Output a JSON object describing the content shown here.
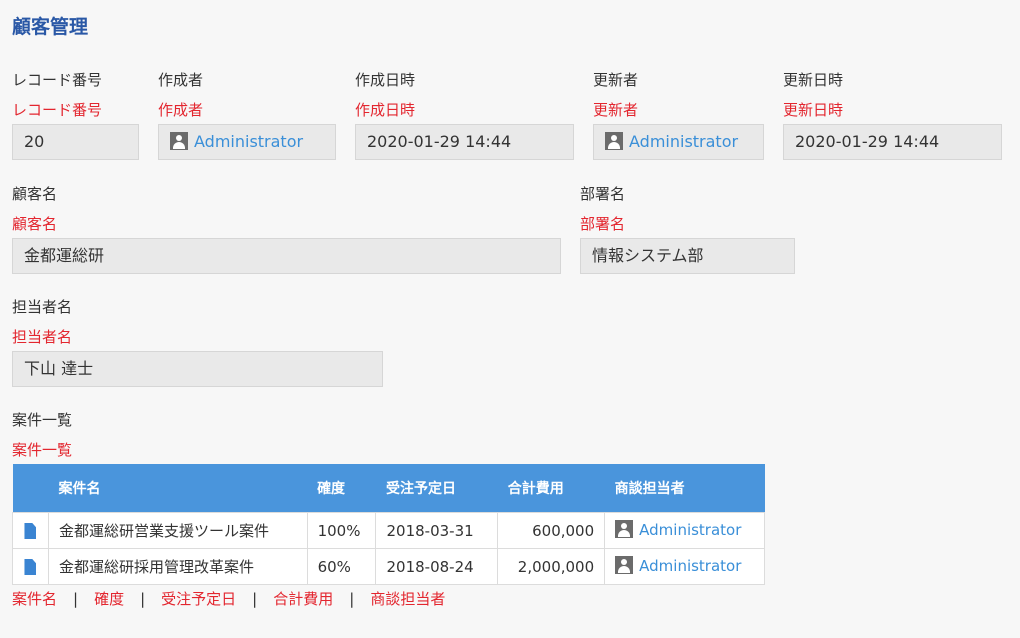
{
  "app": {
    "title": "顧客管理"
  },
  "fields": {
    "record_no": {
      "label": "レコード番号",
      "code": "レコード番号",
      "value": "20"
    },
    "created_by": {
      "label": "作成者",
      "code": "作成者",
      "value": "Administrator"
    },
    "created_at": {
      "label": "作成日時",
      "code": "作成日時",
      "value": "2020-01-29 14:44"
    },
    "updated_by": {
      "label": "更新者",
      "code": "更新者",
      "value": "Administrator"
    },
    "updated_at": {
      "label": "更新日時",
      "code": "更新日時",
      "value": "2020-01-29 14:44"
    },
    "customer_name": {
      "label": "顧客名",
      "code": "顧客名",
      "value": "金都運総研"
    },
    "department": {
      "label": "部署名",
      "code": "部署名",
      "value": "情報システム部"
    },
    "contact_person": {
      "label": "担当者名",
      "code": "担当者名",
      "value": "下山 達士"
    },
    "case_list": {
      "label": "案件一覧",
      "code": "案件一覧"
    }
  },
  "case_table": {
    "headers": [
      "案件名",
      "確度",
      "受注予定日",
      "合計費用",
      "商談担当者"
    ],
    "rows": [
      {
        "name": "金都運総研営業支援ツール案件",
        "probability": "100%",
        "date": "2018-03-31",
        "total": "600,000",
        "owner": "Administrator"
      },
      {
        "name": "金都運総研採用管理改革案件",
        "probability": "60%",
        "date": "2018-08-24",
        "total": "2,000,000",
        "owner": "Administrator"
      }
    ]
  },
  "column_codes": [
    "案件名",
    "確度",
    "受注予定日",
    "合計費用",
    "商談担当者"
  ],
  "column_separator": "|",
  "icons": {
    "user": "user-icon",
    "record": "document-icon"
  },
  "colors": {
    "title": "#2a58a6",
    "field_code": "#e3262f",
    "link": "#3a8fd8",
    "table_header": "#4a95dc"
  }
}
